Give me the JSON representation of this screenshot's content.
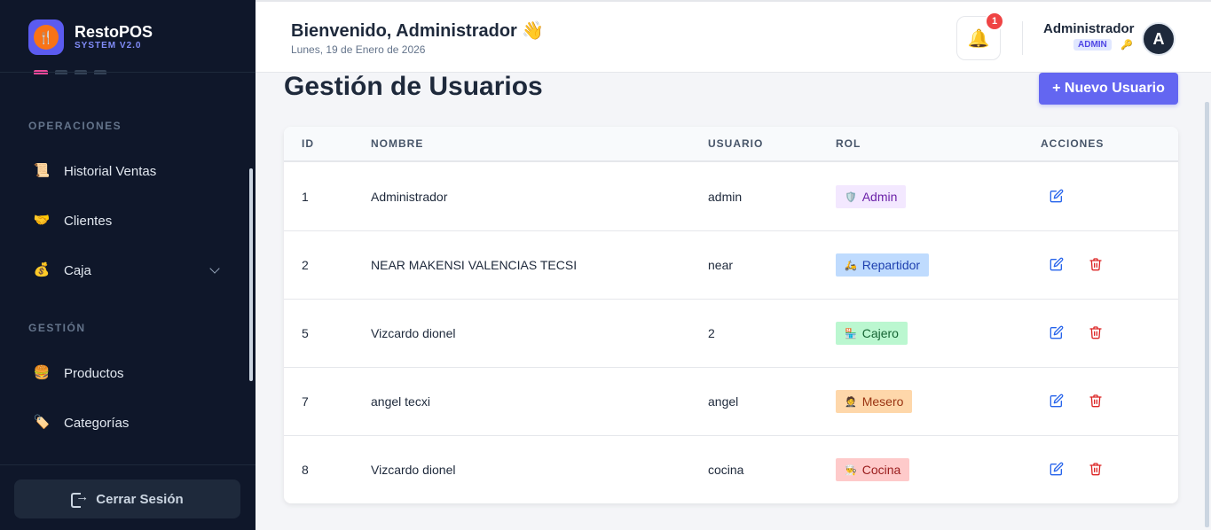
{
  "brand": {
    "name": "RestoPOS",
    "subtitle": "SYSTEM V2.0",
    "logo_icon": "fork-knife-icon"
  },
  "sidebar": {
    "sections": [
      {
        "title": "OPERACIONES",
        "items": [
          {
            "label": "Historial Ventas",
            "icon": "📜"
          },
          {
            "label": "Clientes",
            "icon": "🤝"
          },
          {
            "label": "Caja",
            "icon": "💰"
          }
        ]
      },
      {
        "title": "GESTIÓN",
        "items": [
          {
            "label": "Productos",
            "icon": "🍔"
          },
          {
            "label": "Categorías",
            "icon": "🏷️"
          }
        ]
      }
    ],
    "logout_label": "Cerrar Sesión"
  },
  "header": {
    "welcome": "Bienvenido, Administrador 👋",
    "date": "Lunes, 19 de Enero de 2026",
    "notification_count": "1",
    "user_name": "Administrador",
    "user_role": "ADMIN",
    "avatar_letter": "A"
  },
  "page": {
    "title": "Gestión de Usuarios",
    "new_user_button": "+ Nuevo Usuario"
  },
  "table": {
    "columns": [
      "ID",
      "NOMBRE",
      "USUARIO",
      "ROL",
      "ACCIONES"
    ],
    "rows": [
      {
        "id": "1",
        "nombre": "Administrador",
        "usuario": "admin",
        "rol": "Admin",
        "rol_icon": "🛡️",
        "rol_bg": "#f3e8ff",
        "rol_fg": "#6b21a8",
        "deletable": false
      },
      {
        "id": "2",
        "nombre": "NEAR MAKENSI VALENCIAS TECSI",
        "usuario": "near",
        "rol": "Repartidor",
        "rol_icon": "🛵",
        "rol_bg": "#bfdbfe",
        "rol_fg": "#1e40af",
        "deletable": true
      },
      {
        "id": "5",
        "nombre": "Vizcardo dionel",
        "usuario": "2",
        "rol": "Cajero",
        "rol_icon": "🏪",
        "rol_bg": "#bbf7d0",
        "rol_fg": "#166534",
        "deletable": true
      },
      {
        "id": "7",
        "nombre": "angel tecxi",
        "usuario": "angel",
        "rol": "Mesero",
        "rol_icon": "🤵",
        "rol_bg": "#fed7aa",
        "rol_fg": "#9a3412",
        "deletable": true
      },
      {
        "id": "8",
        "nombre": "Vizcardo dionel",
        "usuario": "cocina",
        "rol": "Cocina",
        "rol_icon": "👨‍🍳",
        "rol_bg": "#fecaca",
        "rol_fg": "#991b1b",
        "deletable": true
      }
    ]
  },
  "colors": {
    "accent": "#6366f1",
    "sidebar_bg": "#0f172a",
    "edit": "#2563eb",
    "delete": "#dc2626"
  }
}
